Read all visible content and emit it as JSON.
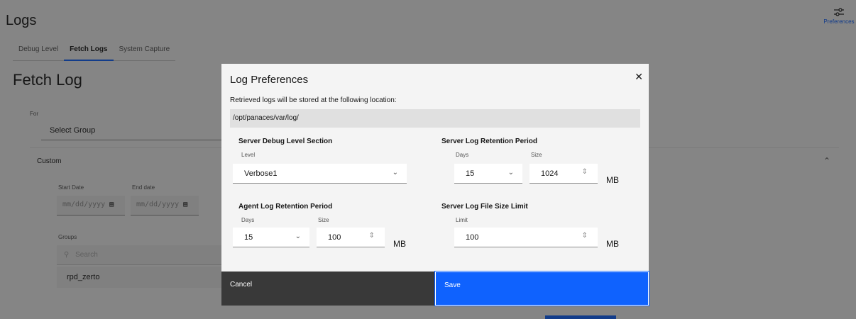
{
  "header": {
    "title": "Logs",
    "preferences_label": "Preferences"
  },
  "tabs": [
    {
      "label": "Debug Level"
    },
    {
      "label": "Fetch Logs"
    },
    {
      "label": "System Capture"
    }
  ],
  "fetch": {
    "title": "Fetch Log",
    "for_label": "For",
    "select_group": "Select Group",
    "custom_label": "Custom",
    "start_label": "Start Date",
    "end_label": "End date",
    "date_placeholder": "mm/dd/yyyy",
    "groups_label": "Groups",
    "search_placeholder": "Search",
    "group_item": "rpd_zerto"
  },
  "modal": {
    "title": "Log Preferences",
    "description": "Retrieved logs will be stored at the following location:",
    "path": "/opt/panaces/var/log/",
    "server_debug": {
      "title": "Server Debug Level Section",
      "level_label": "Level",
      "level_value": "Verbose1"
    },
    "server_retention": {
      "title": "Server Log Retention Period",
      "days_label": "Days",
      "size_label": "Size",
      "days_value": "15",
      "size_value": "1024",
      "unit": "MB"
    },
    "agent_retention": {
      "title": "Agent Log Retention Period",
      "days_label": "Days",
      "size_label": "Size",
      "days_value": "15",
      "size_value": "100",
      "unit": "MB"
    },
    "server_file_limit": {
      "title": "Server Log File Size Limit",
      "limit_label": "Limit",
      "limit_value": "100",
      "unit": "MB"
    },
    "cancel_label": "Cancel",
    "save_label": "Save"
  },
  "colors": {
    "primary": "#0f62fe",
    "secondary_button": "#393939"
  },
  "icons": {
    "preferences": "sliders-icon",
    "close": "close-icon",
    "calendar": "calendar-icon",
    "search": "search-icon",
    "chevron": "chevron-down-icon",
    "stepper": "stepper-icon"
  }
}
